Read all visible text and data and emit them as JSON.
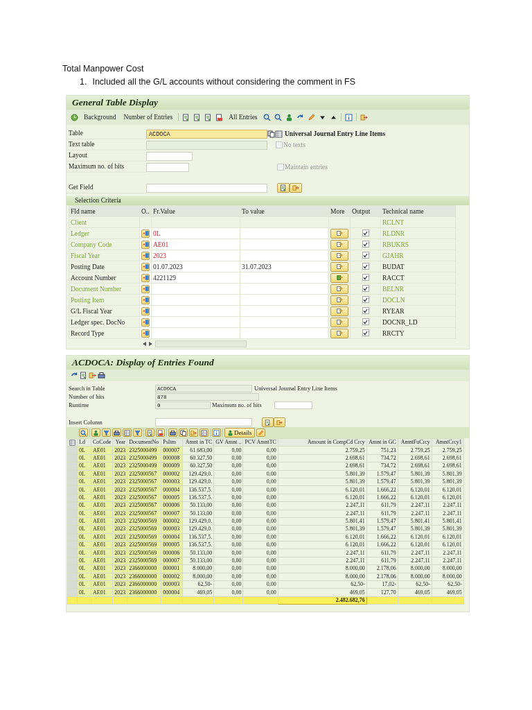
{
  "document": {
    "heading": "Total Manpower Cost",
    "list_items": [
      {
        "number": "1.",
        "text": "Included all the G/L accounts without considering the comment in FS"
      }
    ]
  },
  "general_table_display": {
    "title": "General Table Display",
    "toolbar": [
      "Background",
      "Number of Entries",
      "All Entries"
    ],
    "fields": [
      {
        "label": "Table",
        "kind": "required",
        "value": "ACDOCA",
        "description": "Universal Journal Entry Line Items"
      },
      {
        "label": "Text table",
        "kind": "readonly",
        "checkbox": {
          "label": "No texts",
          "checked": false,
          "disabled": true
        }
      },
      {
        "label": "Layout",
        "kind": "short"
      },
      {
        "label": "Maximum no. of hits",
        "kind": "short",
        "checkbox": {
          "label": "Maintain entries",
          "checked": false,
          "disabled": true
        }
      },
      {
        "label": "Get Field",
        "kind": "action"
      }
    ],
    "selection": {
      "title": "Selection Criteria",
      "columns": [
        "Fld name",
        "O..",
        "Fr.Value",
        "To value",
        "More",
        "Output",
        "Technical name"
      ],
      "rows": [
        {
          "name": "Client",
          "key": true,
          "kind": "fixed",
          "technical": "RCLNT"
        },
        {
          "name": "Ledger",
          "key": true,
          "kind": "select",
          "from": "0L",
          "more_active": false,
          "output": true,
          "technical": "RLDNR"
        },
        {
          "name": "Company Code",
          "key": true,
          "kind": "select",
          "from": "AE01",
          "more_active": false,
          "output": true,
          "technical": "RBUKRS"
        },
        {
          "name": "Fiscal Year",
          "key": true,
          "kind": "select",
          "from": "2023",
          "more_active": false,
          "output": true,
          "technical": "GJAHR"
        },
        {
          "name": "Posting Date",
          "key": false,
          "kind": "select",
          "from": "01.07.2023",
          "to": "31.07.2023",
          "more_active": false,
          "output": true,
          "technical": "BUDAT"
        },
        {
          "name": "Account Number",
          "key": false,
          "kind": "select",
          "from": "4221129",
          "more_active": true,
          "output": true,
          "technical": "RACCT"
        },
        {
          "name": "Document Number",
          "key": true,
          "kind": "select",
          "more_active": false,
          "output": true,
          "technical": "BELNR"
        },
        {
          "name": "Posting Item",
          "key": true,
          "kind": "select",
          "more_active": false,
          "output": true,
          "technical": "DOCLN"
        },
        {
          "name": "G/L Fiscal Year",
          "key": false,
          "kind": "select",
          "more_active": false,
          "output": true,
          "technical": "RYEAR"
        },
        {
          "name": "Ledger spec. DocNo",
          "key": false,
          "kind": "select",
          "more_active": false,
          "output": true,
          "technical": "DOCNR_LD"
        },
        {
          "name": "Record Type",
          "key": false,
          "kind": "select",
          "more_active": false,
          "output": true,
          "technical": "RRCTY"
        }
      ]
    }
  },
  "entries_found": {
    "title": "ACDOCA: Display of Entries Found",
    "info": [
      {
        "label": "Search in Table",
        "value": "ACDOCA",
        "description": "Universal Journal Entry Line Items"
      },
      {
        "label": "Number of hits",
        "value": "878"
      },
      {
        "label": "Runtime",
        "value": "0",
        "extra_label": "Maximum no. of hits"
      }
    ],
    "insert_column": {
      "label": "Insert Column"
    },
    "details_button": "Details",
    "grid": {
      "columns": [
        {
          "label": "Ld",
          "kind": "key"
        },
        {
          "label": "CoCode",
          "kind": "key"
        },
        {
          "label": "Year",
          "kind": "keynum"
        },
        {
          "label": "DocumentNo",
          "kind": "key"
        },
        {
          "label": "PsItm",
          "kind": "key"
        },
        {
          "label": "Amnt in TC",
          "kind": "amount"
        },
        {
          "label": "GV Amnt ..",
          "kind": "amount"
        },
        {
          "label": "PCV AmntTC",
          "kind": "amount"
        },
        {
          "label": "Amount in CompCd Crcy",
          "kind": "amount",
          "total": "2.482.682,76"
        },
        {
          "label": "Amnt in GC",
          "kind": "amount"
        },
        {
          "label": "AmntFuCrcy",
          "kind": "amount"
        },
        {
          "label": "AmntCrcy1",
          "kind": "amount"
        }
      ],
      "rows": [
        [
          "0L",
          "AE01",
          "2023",
          "2325000499",
          "000007",
          "61.683,00",
          "0,00",
          "0,00",
          "2.759,25",
          "751,23",
          "2.759,25",
          "2.759,25"
        ],
        [
          "0L",
          "AE01",
          "2023",
          "2325000499",
          "000008",
          "60.327,50",
          "0,00",
          "0,00",
          "2.698,61",
          "734,72",
          "2.698,61",
          "2.698,61"
        ],
        [
          "0L",
          "AE01",
          "2023",
          "2325000499",
          "000009",
          "60.327,50",
          "0,00",
          "0,00",
          "2.698,61",
          "734,72",
          "2.698,61",
          "2.698,61"
        ],
        [
          "0L",
          "AE01",
          "2023",
          "2325000567",
          "000002",
          "129.429,0.",
          "0,00",
          "0,00",
          "5.801,39",
          "1.579,47",
          "5.801,39",
          "5.801,39"
        ],
        [
          "0L",
          "AE01",
          "2023",
          "2325000567",
          "000003",
          "129.429,0.",
          "0,00",
          "0,00",
          "5.801,39",
          "1.579,47",
          "5.801,39",
          "5.801,39"
        ],
        [
          "0L",
          "AE01",
          "2023",
          "2325000567",
          "000004",
          "136.537,5.",
          "0,00",
          "0,00",
          "6.120,01",
          "1.666,22",
          "6.120,01",
          "6.120,01"
        ],
        [
          "0L",
          "AE01",
          "2023",
          "2325000567",
          "000005",
          "136.537,5.",
          "0,00",
          "0,00",
          "6.120,01",
          "1.666,22",
          "6.120,01",
          "6.120,01"
        ],
        [
          "0L",
          "AE01",
          "2023",
          "2325000567",
          "000006",
          "50.133,00",
          "0,00",
          "0,00",
          "2.247,11",
          "611,79",
          "2.247,11",
          "2.247,11"
        ],
        [
          "0L",
          "AE01",
          "2023",
          "2325000567",
          "000007",
          "50.133,00",
          "0,00",
          "0,00",
          "2.247,11",
          "611,79",
          "2.247,11",
          "2.247,11"
        ],
        [
          "0L",
          "AE01",
          "2023",
          "2325000569",
          "000002",
          "129.429,0.",
          "0,00",
          "0,00",
          "5.801,41",
          "1.579,47",
          "5.801,41",
          "5.801,41"
        ],
        [
          "0L",
          "AE01",
          "2023",
          "2325000569",
          "000003",
          "129.429,0.",
          "0,00",
          "0,00",
          "5.801,39",
          "1.579,47",
          "5.801,39",
          "5.801,39"
        ],
        [
          "0L",
          "AE01",
          "2023",
          "2325000569",
          "000004",
          "136.537,5.",
          "0,00",
          "0,00",
          "6.120,01",
          "1.666,22",
          "6.120,01",
          "6.120,01"
        ],
        [
          "0L",
          "AE01",
          "2023",
          "2325000569",
          "000005",
          "136.537,5.",
          "0,00",
          "0,00",
          "6.120,01",
          "1.666,22",
          "6.120,01",
          "6.120,01"
        ],
        [
          "0L",
          "AE01",
          "2023",
          "2325000569",
          "000006",
          "50.133,00",
          "0,00",
          "0,00",
          "2.247,11",
          "611,79",
          "2.247,11",
          "2.247,11"
        ],
        [
          "0L",
          "AE01",
          "2023",
          "2325000569",
          "000007",
          "50.133,00",
          "0,00",
          "0,00",
          "2.247,11",
          "611,79",
          "2.247,11",
          "2.247,11"
        ],
        [
          "0L",
          "AE01",
          "2023",
          "2366000000",
          "000001",
          "8.000,00",
          "0,00",
          "0,00",
          "8.000,00",
          "2.178,06",
          "8.000,00",
          "8.000,00"
        ],
        [
          "0L",
          "AE01",
          "2023",
          "2366000000",
          "000002",
          "8.000,00",
          "0,00",
          "0,00",
          "8.000,00",
          "2.178,06",
          "8.000,00",
          "8.000,00"
        ],
        [
          "0L",
          "AE01",
          "2023",
          "2366000000",
          "000003",
          "62,50-",
          "0,00",
          "0,00",
          "62,50-",
          "17,02-",
          "62,50-",
          "62,50-"
        ],
        [
          "0L",
          "AE01",
          "2023",
          "2366000000",
          "000004",
          "469,05",
          "0,00",
          "0,00",
          "469,05",
          "127,70",
          "469,05",
          "469,05"
        ]
      ]
    }
  }
}
